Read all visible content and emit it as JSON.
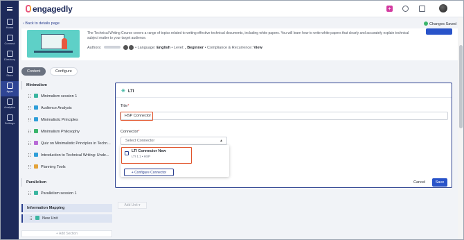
{
  "sidebar": {
    "items": [
      {
        "label": "Home",
        "icon": "home-icon"
      },
      {
        "label": "Connect",
        "icon": "connect-icon"
      },
      {
        "label": "Directory",
        "icon": "directory-icon"
      },
      {
        "label": "Store",
        "icon": "store-icon"
      },
      {
        "label": "Apps",
        "icon": "apps-icon"
      },
      {
        "label": "Analytics",
        "icon": "analytics-icon"
      },
      {
        "label": "Settings",
        "icon": "settings-icon"
      }
    ]
  },
  "topbar": {
    "logo": "engagedly"
  },
  "header": {
    "back_label": "Back to details page",
    "saved_label": "Changes Saved"
  },
  "course": {
    "description": "The Technical Writing Course covers a range of topics related to writing effective technical documents, including white papers. You will learn how to write white papers that clearly and accurately explain technical subject matter to your target audience.",
    "authors_label": "Authors:",
    "language_label": "• Language:",
    "language_value": "English",
    "level_label": "• Level:",
    "level_value": ",",
    "level_value2": "Beginner",
    "compliance_label": "• Compliance & Recurrence:",
    "compliance_value": "View"
  },
  "tabs": [
    {
      "label": "Content",
      "active": true
    },
    {
      "label": "Configure",
      "active": false
    }
  ],
  "outline": {
    "sections": [
      {
        "title": "Minimalism",
        "items": [
          {
            "label": "Minimalism session 1",
            "icon": "session-icon",
            "color": "#3bb5a0"
          },
          {
            "label": "Audience Analysis",
            "icon": "document-icon",
            "color": "#2f9ed8"
          },
          {
            "label": "Minimalistic Principles",
            "icon": "document-icon",
            "color": "#2f9ed8"
          },
          {
            "label": "Minimalism Philosophy",
            "icon": "text-icon",
            "color": "#3bb56b"
          },
          {
            "label": "Quiz on Minimalistic Principles in Techn...",
            "icon": "quiz-icon",
            "color": "#b86bd6"
          },
          {
            "label": "Introduction to Technical Writing: Unde...",
            "icon": "document-icon",
            "color": "#2f9ed8"
          },
          {
            "label": "Planning Tools",
            "icon": "document-icon",
            "color": "#e3a33a"
          }
        ]
      },
      {
        "title": "Parallelism",
        "items": [
          {
            "label": "Parallelism session 1",
            "icon": "session-icon",
            "color": "#3bb5a0"
          }
        ]
      },
      {
        "title": "Information Mapping",
        "items": [
          {
            "label": "New Unit",
            "icon": "lti-icon",
            "color": "#3bb5a0"
          }
        ]
      }
    ],
    "add_section_label": "+ Add Section"
  },
  "editor": {
    "heading": "LTI",
    "title_label": "Title",
    "title_value": "HSP Connector",
    "connector_label": "Connector",
    "connector_placeholder": "Select Connector",
    "options": [
      {
        "title": "LTI Connector New",
        "subtitle": "LTI 1.1  •  HSP"
      }
    ],
    "configure_label": "+ Configure Connector",
    "cancel_label": "Cancel",
    "save_label": "Save"
  },
  "add_unit_label": "Add Unit ▾",
  "colors": {
    "sidebar": "#1d2a5a",
    "primary": "#2953c9",
    "highlight": "#e1532a",
    "success": "#3bb56b"
  }
}
